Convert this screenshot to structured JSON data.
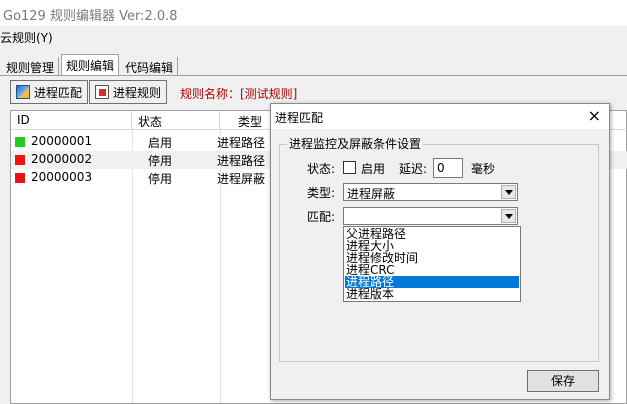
{
  "app": {
    "title": "Go129 规则编辑器  Ver:2.0.8"
  },
  "menu": {
    "items": [
      {
        "label": "云规则(Y)"
      }
    ]
  },
  "tabs": [
    {
      "label": "规则管理"
    },
    {
      "label": "规则编辑"
    },
    {
      "label": "代码编辑"
    }
  ],
  "toolbar": {
    "match_button": "进程匹配",
    "rule_button": "进程规则",
    "rule_name": "规则名称：[测试规则]"
  },
  "table": {
    "columns": [
      "ID",
      "状态",
      "类型"
    ],
    "rows": [
      {
        "id": "20000001",
        "status": "启用",
        "type": "进程路径",
        "color": "#22cc22"
      },
      {
        "id": "20000002",
        "status": "停用",
        "type": "进程路径",
        "color": "#ee1111"
      },
      {
        "id": "20000003",
        "status": "停用",
        "type": "进程屏蔽",
        "color": "#ee1111"
      }
    ]
  },
  "dialog": {
    "title": "进程匹配",
    "close_icon": "×",
    "group_title": "进程监控及屏蔽条件设置",
    "status_label": "状态:",
    "enabled_label": "启用",
    "enabled_checked": false,
    "delay_label": "延迟:",
    "delay_value": "0",
    "delay_unit": "毫秒",
    "type_label": "类型:",
    "type_value": "进程屏蔽",
    "match_label": "匹配:",
    "match_value": "",
    "match_options": [
      "父进程路径",
      "进程大小",
      "进程修改时间",
      "进程CRC",
      "进程路径",
      "进程版本"
    ],
    "match_highlighted": "进程路径",
    "save_button": "保存"
  }
}
